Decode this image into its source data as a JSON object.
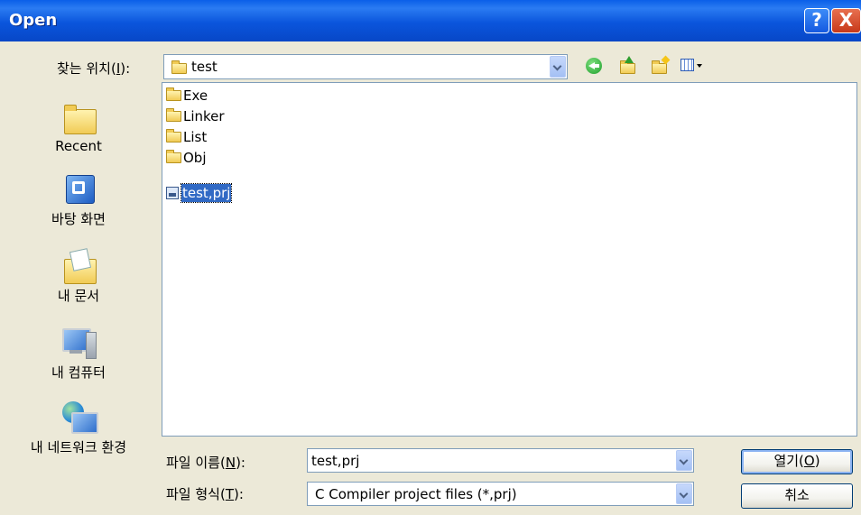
{
  "window": {
    "title": "Open"
  },
  "title_buttons": {
    "help": "?",
    "close": "X"
  },
  "lookin": {
    "label_pre": "찾는 위치(",
    "label_key": "I",
    "label_post": "):",
    "value": "test"
  },
  "places": [
    {
      "label": "Recent",
      "icon": "recent-folder-icon"
    },
    {
      "label": "바탕 화면",
      "icon": "desktop-icon"
    },
    {
      "label": "내 문서",
      "icon": "my-documents-icon"
    },
    {
      "label": "내 컴퓨터",
      "icon": "my-computer-icon"
    },
    {
      "label": "내 네트워크 환경",
      "icon": "network-places-icon"
    }
  ],
  "files": [
    {
      "name": "Exe",
      "type": "folder"
    },
    {
      "name": "Linker",
      "type": "folder"
    },
    {
      "name": "List",
      "type": "folder"
    },
    {
      "name": "Obj",
      "type": "folder"
    },
    {
      "name": "test,prj",
      "type": "project",
      "selected": true
    }
  ],
  "filename": {
    "label_pre": "파일 이름(",
    "label_key": "N",
    "label_post": "):",
    "value": "test,prj"
  },
  "filetype": {
    "label_pre": "파일 형식(",
    "label_key": "T",
    "label_post": "):",
    "value": "C Compiler project files (*,prj)"
  },
  "buttons": {
    "open_pre": "열기(",
    "open_key": "O",
    "open_post": ")",
    "cancel": "취소"
  },
  "colors": {
    "title_bar": "#0A55DC",
    "selection": "#316AC5",
    "dialog_bg": "#ECE9D8"
  }
}
